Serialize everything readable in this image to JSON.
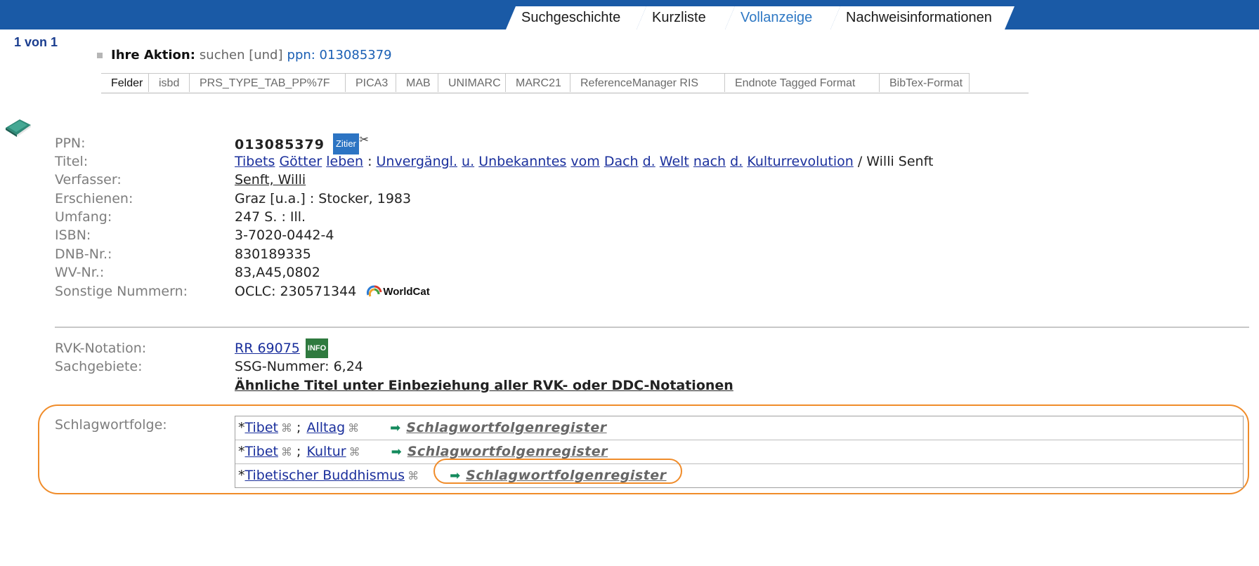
{
  "nav": {
    "tabs": [
      {
        "label": "Suchgeschichte",
        "active": false
      },
      {
        "label": "Kurzliste",
        "active": false
      },
      {
        "label": "Vollanzeige",
        "active": true
      },
      {
        "label": "Nachweisinformationen",
        "active": false
      }
    ]
  },
  "pager": "1 von 1",
  "action": {
    "label": "Ihre Aktion:",
    "verb": "suchen [und]",
    "query": "ppn: 013085379"
  },
  "format_tabs": [
    "Felder",
    "isbd",
    "PRS_TYPE_TAB_PP%7F",
    "PICA3",
    "MAB",
    "UNIMARC",
    "MARC21",
    "ReferenceManager RIS",
    "Endnote Tagged Format",
    "BibTex-Format"
  ],
  "record": {
    "ppn_label": "PPN:",
    "ppn": "013085379",
    "zitier": "Zitier",
    "title_label": "Titel:",
    "title_words": [
      "Tibets",
      "Götter",
      "leben",
      ":",
      "Unvergängl.",
      "u.",
      "Unbekanntes",
      "vom",
      "Dach",
      "d.",
      "Welt",
      "nach",
      "d.",
      "Kulturrevolution"
    ],
    "title_suffix": "/ Willi Senft",
    "author_label": "Verfasser:",
    "author": "Senft, Willi",
    "published_label": "Erschienen:",
    "published": "Graz [u.a.] : Stocker, 1983",
    "extent_label": "Umfang:",
    "extent": "247 S. : Ill.",
    "isbn_label": "ISBN:",
    "isbn": "3-7020-0442-4",
    "dnb_label": "DNB-Nr.:",
    "dnb": "830189335",
    "wv_label": "WV-Nr.:",
    "wv": "83,A45,0802",
    "other_label": "Sonstige Nummern:",
    "other": "OCLC: 230571344",
    "worldcat": "WorldCat"
  },
  "subject": {
    "rvk_label": "RVK-Notation:",
    "rvk": "RR 69075",
    "info_badge": "INFO",
    "sach_label": "Sachgebiete:",
    "sach": "SSG-Nummer: 6,24",
    "similar": "Ähnliche Titel unter Einbeziehung aller RVK- oder DDC-Notationen"
  },
  "schlagwort": {
    "label": "Schlagwortfolge:",
    "register_label": "Schlagwortfolgenregister",
    "rows": [
      {
        "terms": [
          "Tibet",
          "Alltag"
        ]
      },
      {
        "terms": [
          "Tibet",
          "Kultur"
        ]
      },
      {
        "terms": [
          "Tibetischer Buddhismus"
        ]
      }
    ]
  },
  "colors": {
    "topbar": "#1a5aa6",
    "highlight": "#f08c2a",
    "link": "#1a2f9c",
    "similar": "#138a1f"
  }
}
